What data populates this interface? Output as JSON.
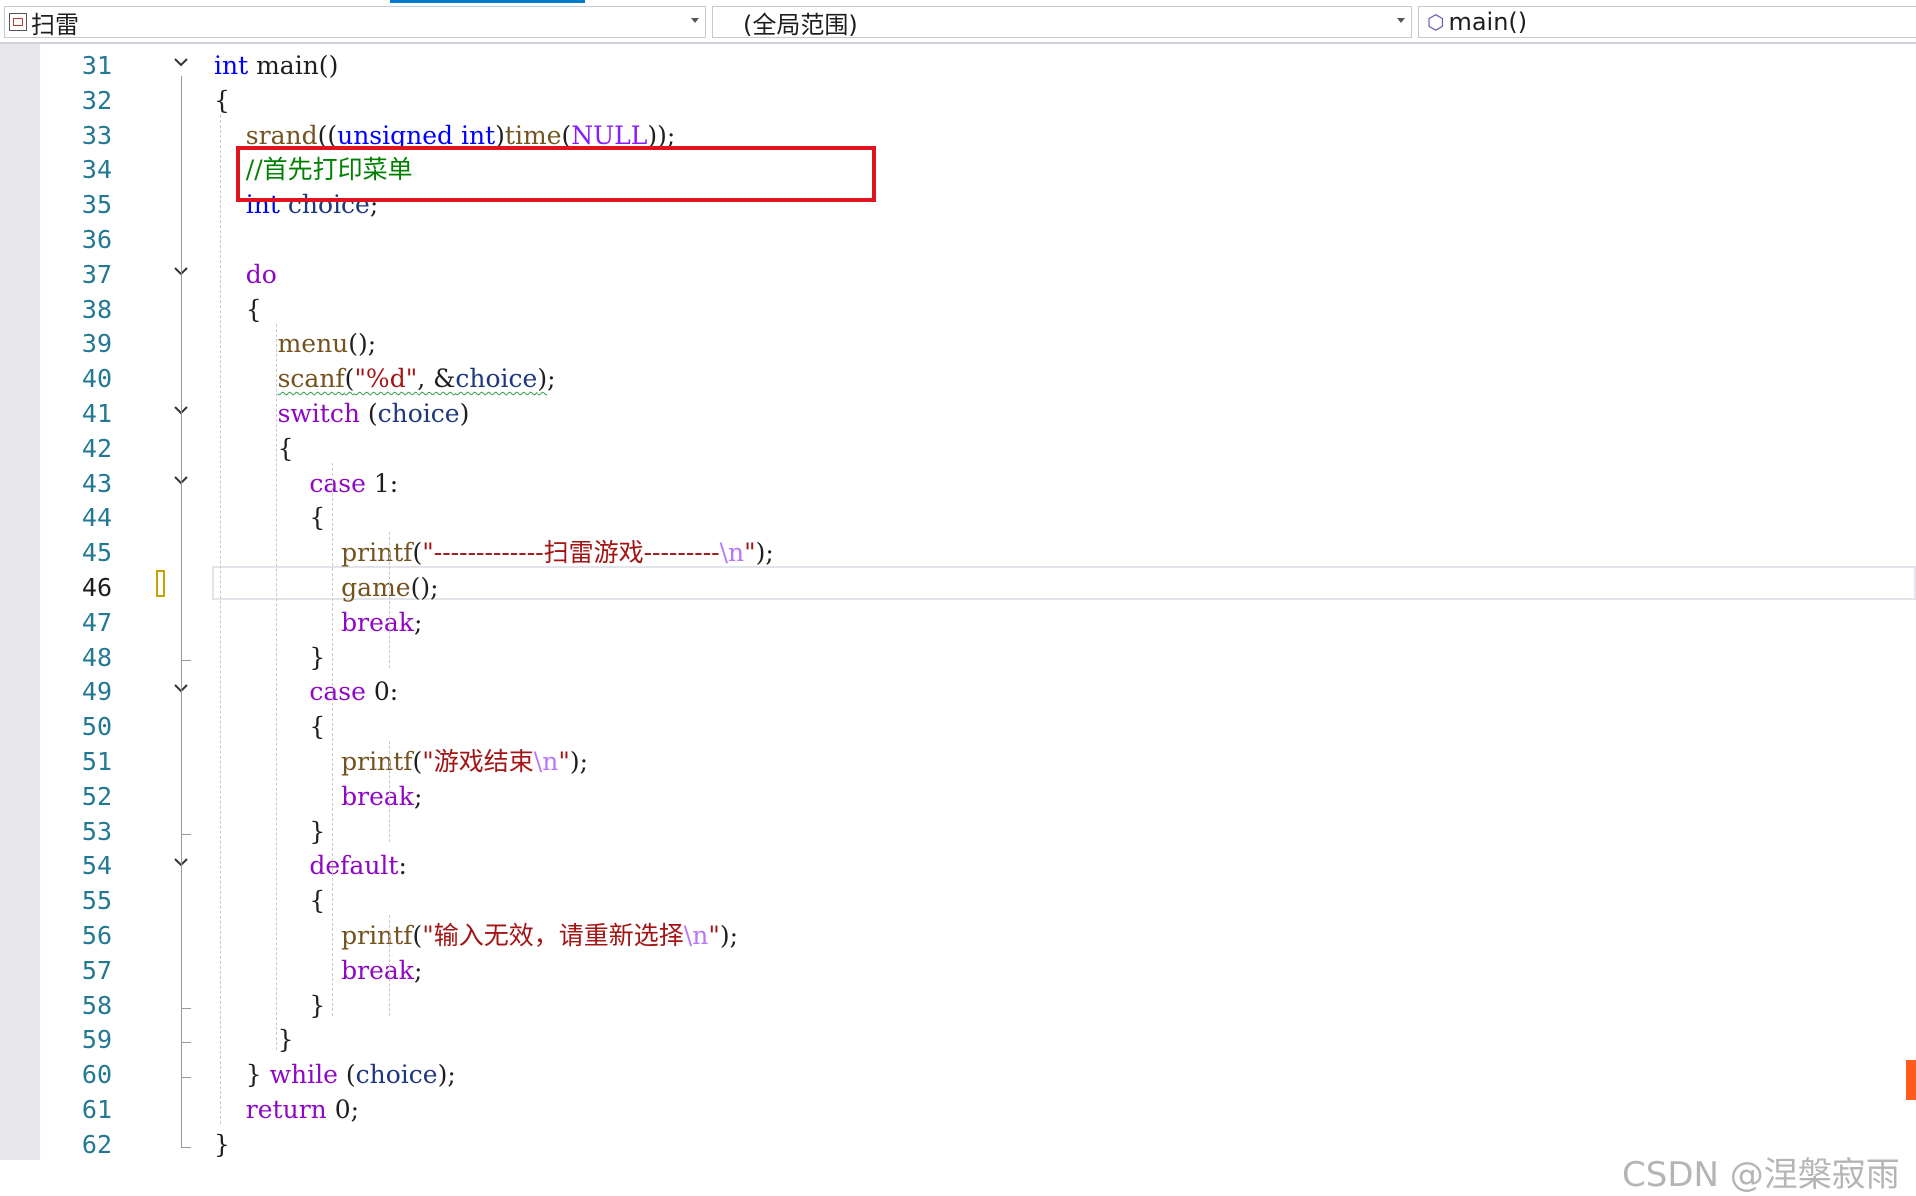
{
  "navbar": {
    "project": "扫雷",
    "scope": "(全局范围)",
    "member": "main()"
  },
  "editor": {
    "current_line": 46,
    "lines": [
      {
        "n": "31",
        "fold": true,
        "tokens": [
          {
            "c": "kw",
            "t": "int"
          },
          {
            "c": "",
            "t": " main()"
          }
        ]
      },
      {
        "n": "32",
        "tokens": [
          {
            "c": "",
            "t": "{"
          }
        ]
      },
      {
        "n": "33",
        "tokens": [
          {
            "c": "",
            "t": "    "
          },
          {
            "c": "fn",
            "t": "srand"
          },
          {
            "c": "",
            "t": "(("
          },
          {
            "c": "kw",
            "t": "unsigned int"
          },
          {
            "c": "",
            "t": ")"
          },
          {
            "c": "fn",
            "t": "time"
          },
          {
            "c": "",
            "t": "("
          },
          {
            "c": "mac",
            "t": "NULL"
          },
          {
            "c": "",
            "t": "));"
          }
        ]
      },
      {
        "n": "34",
        "tokens": [
          {
            "c": "",
            "t": "    "
          },
          {
            "c": "cmt",
            "t": "//首先打印菜单"
          }
        ]
      },
      {
        "n": "35",
        "tokens": [
          {
            "c": "",
            "t": "    "
          },
          {
            "c": "kw",
            "t": "int"
          },
          {
            "c": "",
            "t": " "
          },
          {
            "c": "var",
            "t": "choice"
          },
          {
            "c": "",
            "t": ";"
          }
        ]
      },
      {
        "n": "36",
        "tokens": []
      },
      {
        "n": "37",
        "fold": true,
        "tokens": [
          {
            "c": "",
            "t": "    "
          },
          {
            "c": "ctl",
            "t": "do"
          }
        ]
      },
      {
        "n": "38",
        "tokens": [
          {
            "c": "",
            "t": "    {"
          }
        ]
      },
      {
        "n": "39",
        "tokens": [
          {
            "c": "",
            "t": "        "
          },
          {
            "c": "fn",
            "t": "menu"
          },
          {
            "c": "",
            "t": "();"
          }
        ]
      },
      {
        "n": "40",
        "tokens": [
          {
            "c": "",
            "t": "        "
          },
          {
            "c": "fn squiggle",
            "t": "scanf"
          },
          {
            "c": "squiggle",
            "t": "("
          },
          {
            "c": "str squiggle",
            "t": "\"%d\""
          },
          {
            "c": "squiggle",
            "t": ", &"
          },
          {
            "c": "var squiggle",
            "t": "choice"
          },
          {
            "c": "squiggle",
            "t": ")"
          },
          {
            "c": "",
            "t": ";"
          }
        ]
      },
      {
        "n": "41",
        "fold": true,
        "tokens": [
          {
            "c": "",
            "t": "        "
          },
          {
            "c": "ctl",
            "t": "switch"
          },
          {
            "c": "",
            "t": " ("
          },
          {
            "c": "var",
            "t": "choice"
          },
          {
            "c": "",
            "t": ")"
          }
        ]
      },
      {
        "n": "42",
        "tokens": [
          {
            "c": "",
            "t": "        {"
          }
        ]
      },
      {
        "n": "43",
        "fold": true,
        "tokens": [
          {
            "c": "",
            "t": "            "
          },
          {
            "c": "ctl",
            "t": "case"
          },
          {
            "c": "",
            "t": " 1:"
          }
        ]
      },
      {
        "n": "44",
        "tokens": [
          {
            "c": "",
            "t": "            {"
          }
        ]
      },
      {
        "n": "45",
        "tokens": [
          {
            "c": "",
            "t": "                "
          },
          {
            "c": "fn",
            "t": "printf"
          },
          {
            "c": "",
            "t": "("
          },
          {
            "c": "str",
            "t": "\"-------------扫雷游戏---------"
          },
          {
            "c": "esc",
            "t": "\\n"
          },
          {
            "c": "str",
            "t": "\""
          },
          {
            "c": "",
            "t": ");"
          }
        ]
      },
      {
        "n": "46",
        "tokens": [
          {
            "c": "",
            "t": "                "
          },
          {
            "c": "fn",
            "t": "game"
          },
          {
            "c": "",
            "t": "();"
          }
        ]
      },
      {
        "n": "47",
        "tokens": [
          {
            "c": "",
            "t": "                "
          },
          {
            "c": "ctl",
            "t": "break"
          },
          {
            "c": "",
            "t": ";"
          }
        ]
      },
      {
        "n": "48",
        "tokens": [
          {
            "c": "",
            "t": "            }"
          }
        ]
      },
      {
        "n": "49",
        "fold": true,
        "tokens": [
          {
            "c": "",
            "t": "            "
          },
          {
            "c": "ctl",
            "t": "case"
          },
          {
            "c": "",
            "t": " 0:"
          }
        ]
      },
      {
        "n": "50",
        "tokens": [
          {
            "c": "",
            "t": "            {"
          }
        ]
      },
      {
        "n": "51",
        "tokens": [
          {
            "c": "",
            "t": "                "
          },
          {
            "c": "fn",
            "t": "printf"
          },
          {
            "c": "",
            "t": "("
          },
          {
            "c": "str",
            "t": "\"游戏结束"
          },
          {
            "c": "esc",
            "t": "\\n"
          },
          {
            "c": "str",
            "t": "\""
          },
          {
            "c": "",
            "t": ");"
          }
        ]
      },
      {
        "n": "52",
        "tokens": [
          {
            "c": "",
            "t": "                "
          },
          {
            "c": "ctl",
            "t": "break"
          },
          {
            "c": "",
            "t": ";"
          }
        ]
      },
      {
        "n": "53",
        "tokens": [
          {
            "c": "",
            "t": "            }"
          }
        ]
      },
      {
        "n": "54",
        "fold": true,
        "tokens": [
          {
            "c": "",
            "t": "            "
          },
          {
            "c": "ctl",
            "t": "default"
          },
          {
            "c": "",
            "t": ":"
          }
        ]
      },
      {
        "n": "55",
        "tokens": [
          {
            "c": "",
            "t": "            {"
          }
        ]
      },
      {
        "n": "56",
        "tokens": [
          {
            "c": "",
            "t": "                "
          },
          {
            "c": "fn",
            "t": "printf"
          },
          {
            "c": "",
            "t": "("
          },
          {
            "c": "str",
            "t": "\"输入无效，请重新选择"
          },
          {
            "c": "esc",
            "t": "\\n"
          },
          {
            "c": "str",
            "t": "\""
          },
          {
            "c": "",
            "t": ");"
          }
        ]
      },
      {
        "n": "57",
        "tokens": [
          {
            "c": "",
            "t": "                "
          },
          {
            "c": "ctl",
            "t": "break"
          },
          {
            "c": "",
            "t": ";"
          }
        ]
      },
      {
        "n": "58",
        "tokens": [
          {
            "c": "",
            "t": "            }"
          }
        ]
      },
      {
        "n": "59",
        "tokens": [
          {
            "c": "",
            "t": "        }"
          }
        ]
      },
      {
        "n": "60",
        "tokens": [
          {
            "c": "",
            "t": "    } "
          },
          {
            "c": "ctl",
            "t": "while"
          },
          {
            "c": "",
            "t": " ("
          },
          {
            "c": "var",
            "t": "choice"
          },
          {
            "c": "",
            "t": ");"
          }
        ]
      },
      {
        "n": "61",
        "tokens": [
          {
            "c": "",
            "t": "    "
          },
          {
            "c": "ctl",
            "t": "return"
          },
          {
            "c": "",
            "t": " 0;"
          }
        ]
      },
      {
        "n": "62",
        "tokens": [
          {
            "c": "",
            "t": "}"
          }
        ]
      }
    ]
  },
  "watermark": "CSDN @涅槃寂雨"
}
